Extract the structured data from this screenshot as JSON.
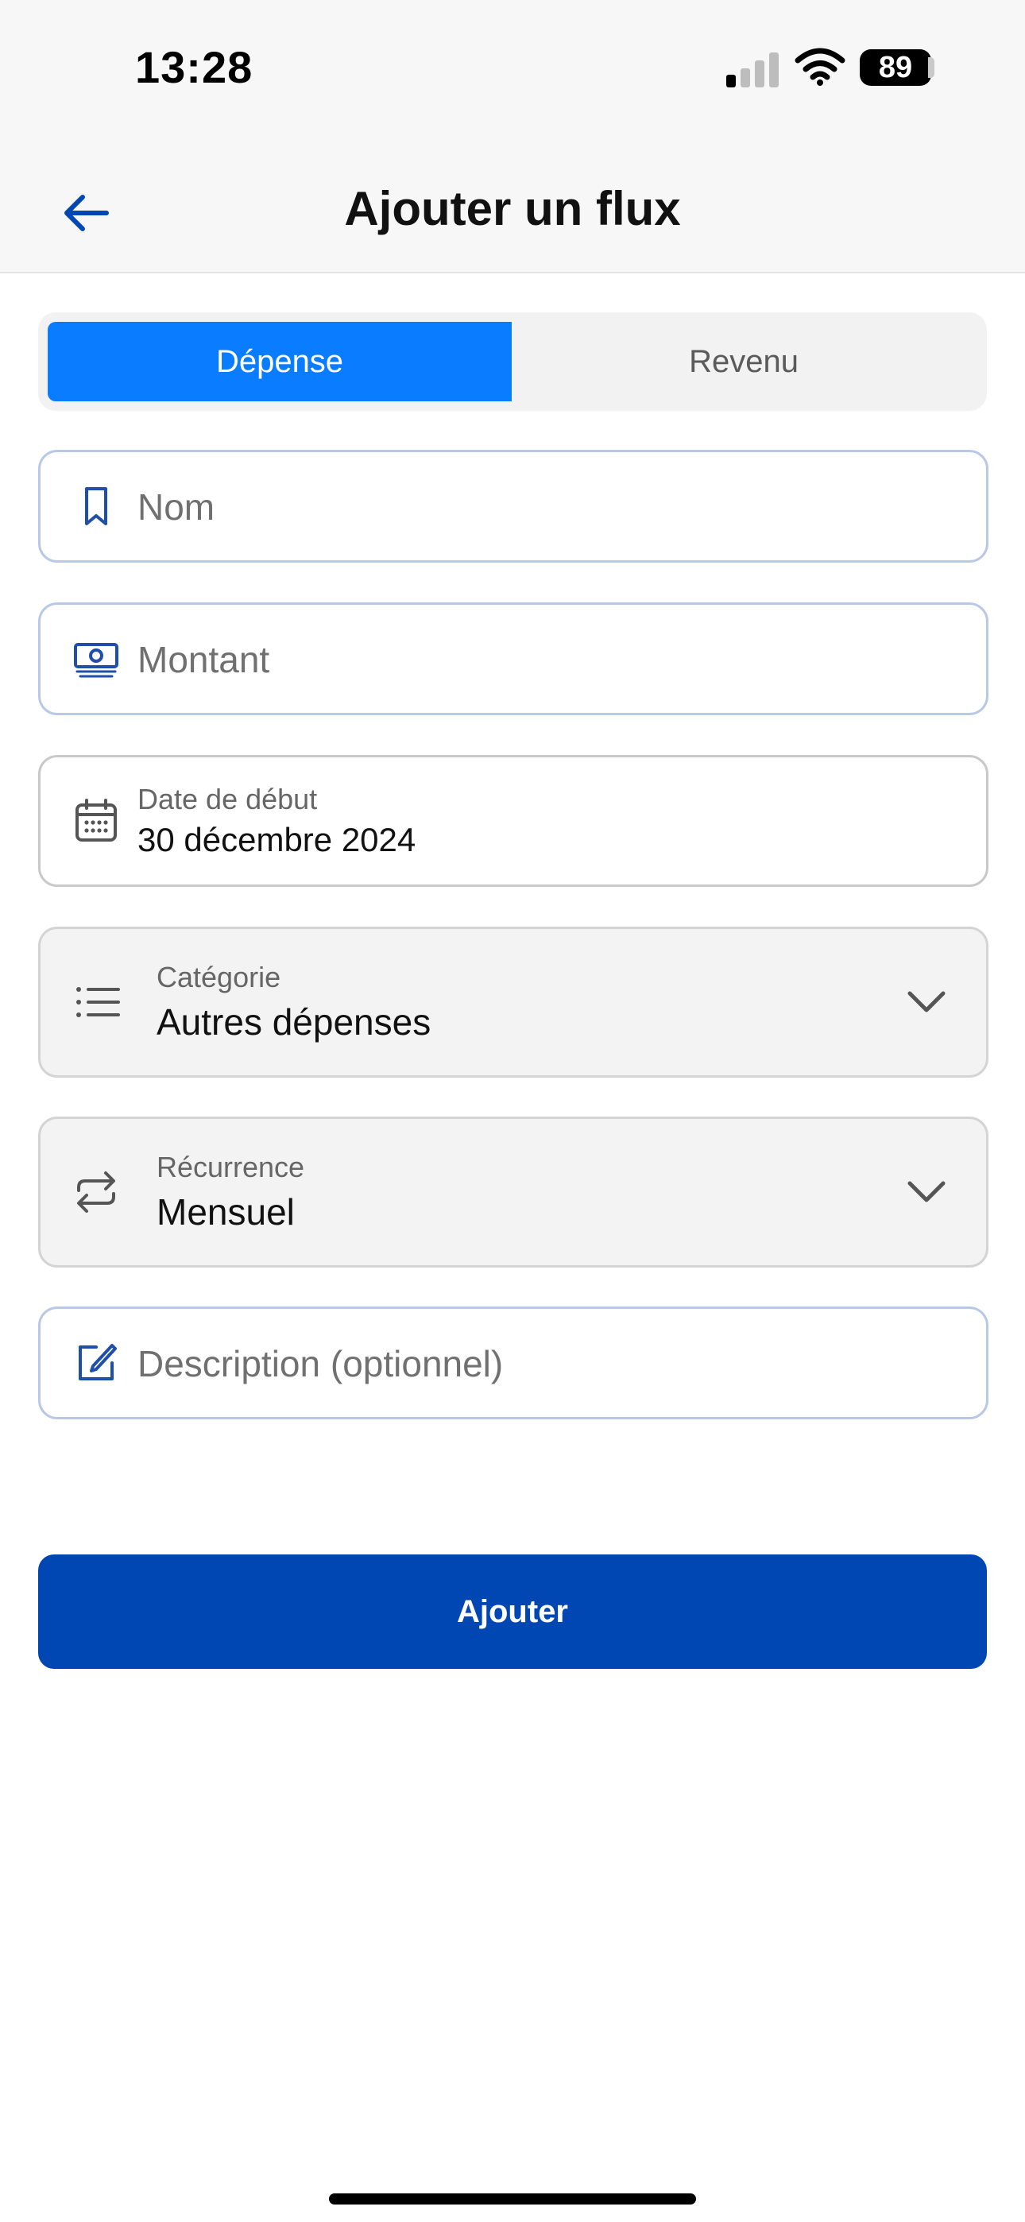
{
  "status_bar": {
    "time": "13:28",
    "battery": "89",
    "signal_icon": "cellular-signal-icon",
    "wifi_icon": "wifi-icon"
  },
  "header": {
    "title": "Ajouter un flux",
    "back_icon": "arrow-left-icon"
  },
  "type_toggle": {
    "options": [
      "Dépense",
      "Revenu"
    ],
    "selected": "Dépense"
  },
  "form": {
    "name": {
      "placeholder": "Nom",
      "icon": "bookmark-icon"
    },
    "amount": {
      "placeholder": "Montant",
      "icon": "banknote-icon"
    },
    "start_date": {
      "label": "Date de début",
      "value": "30 décembre 2024",
      "icon": "calendar-icon"
    },
    "category": {
      "label": "Catégorie",
      "value": "Autres dépenses",
      "icon": "list-icon"
    },
    "recurrence": {
      "label": "Récurrence",
      "value": "Mensuel",
      "icon": "repeat-icon"
    },
    "description": {
      "placeholder": "Description (optionnel)",
      "icon": "edit-icon"
    }
  },
  "submit": {
    "label": "Ajouter"
  },
  "colors": {
    "accent": "#0a7cff",
    "primary_button": "#0047b3",
    "icon_blue": "#1f4fa8"
  }
}
